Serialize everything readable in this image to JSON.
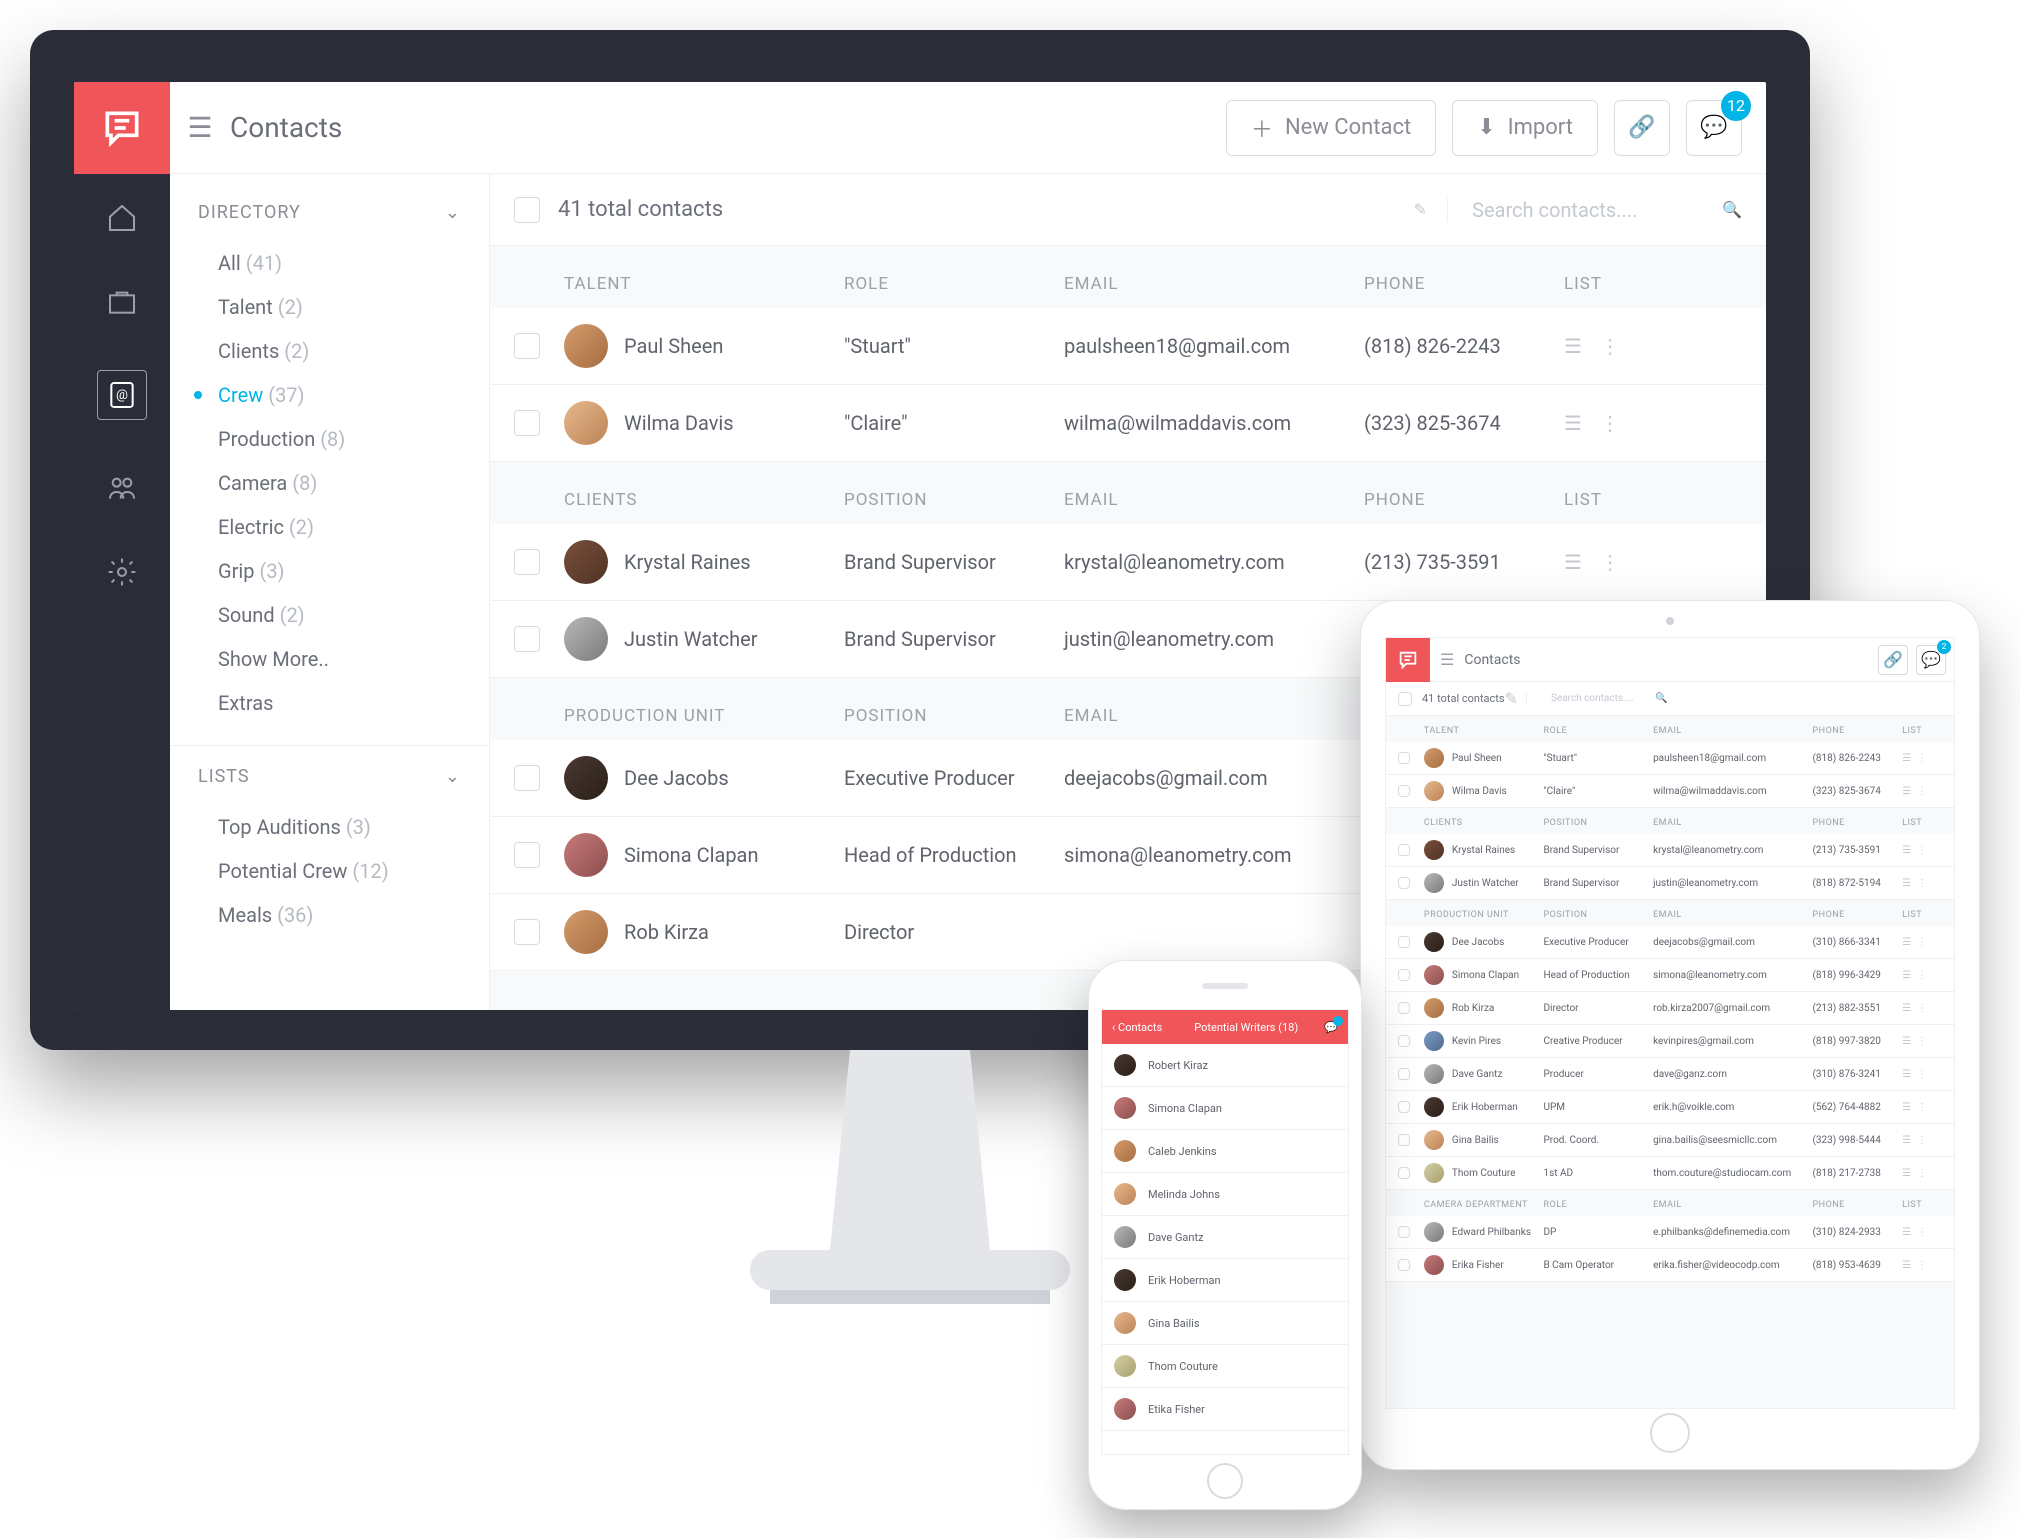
{
  "brand_color": "#f0555a",
  "accent_color": "#00b5e6",
  "desktop": {
    "page_title": "Contacts",
    "new_contact": "New Contact",
    "import": "Import",
    "chat_badge": "12",
    "total_contacts": "41 total contacts",
    "search_placeholder": "Search contacts....",
    "sidebar": {
      "directory_label": "DIRECTORY",
      "lists_label": "LISTS",
      "directory": [
        {
          "label": "All",
          "count": "(41)"
        },
        {
          "label": "Talent",
          "count": "(2)"
        },
        {
          "label": "Clients",
          "count": "(2)"
        },
        {
          "label": "Crew",
          "count": "(37)",
          "selected": true,
          "children": [
            {
              "label": "Production",
              "count": "(8)"
            },
            {
              "label": "Camera",
              "count": "(8)"
            },
            {
              "label": "Electric",
              "count": "(2)"
            },
            {
              "label": "Grip",
              "count": "(3)"
            },
            {
              "label": "Sound",
              "count": "(2)"
            },
            {
              "label": "Show More.."
            }
          ]
        },
        {
          "label": "Extras"
        }
      ],
      "lists": [
        {
          "label": "Top Auditions",
          "count": "(3)"
        },
        {
          "label": "Potential Crew",
          "count": "(12)"
        },
        {
          "label": "Meals",
          "count": "(36)"
        }
      ]
    },
    "groups": [
      {
        "title": "TALENT",
        "cols": [
          "ROLE",
          "EMAIL",
          "PHONE",
          "LIST"
        ],
        "rows": [
          {
            "name": "Paul Sheen",
            "role": "\"Stuart\"",
            "email": "paulsheen18@gmail.com",
            "phone": "(818) 826-2243",
            "av": "a1"
          },
          {
            "name": "Wilma Davis",
            "role": "\"Claire\"",
            "email": "wilma@wilmaddavis.com",
            "phone": "(323) 825-3674",
            "av": "a2"
          }
        ]
      },
      {
        "title": "CLIENTS",
        "cols": [
          "POSITION",
          "EMAIL",
          "PHONE",
          "LIST"
        ],
        "rows": [
          {
            "name": "Krystal Raines",
            "role": "Brand Supervisor",
            "email": "krystal@leanometry.com",
            "phone": "(213) 735-3591",
            "av": "a3"
          },
          {
            "name": "Justin Watcher",
            "role": "Brand Supervisor",
            "email": "justin@leanometry.com",
            "phone": "",
            "av": "a4"
          }
        ]
      },
      {
        "title": "PRODUCTION UNIT",
        "cols": [
          "POSITION",
          "EMAIL",
          "",
          ""
        ],
        "rows": [
          {
            "name": "Dee Jacobs",
            "role": "Executive Producer",
            "email": "deejacobs@gmail.com",
            "phone": "",
            "av": "a5"
          },
          {
            "name": "Simona Clapan",
            "role": "Head of Production",
            "email": "simona@leanometry.com",
            "phone": "",
            "av": "a6"
          },
          {
            "name": "Rob Kirza",
            "role": "Director",
            "email": "",
            "phone": "",
            "av": "a1"
          }
        ]
      }
    ]
  },
  "tablet": {
    "page_title": "Contacts",
    "chat_badge": "2",
    "total_contacts": "41 total contacts",
    "search_placeholder": "Search contacts....",
    "groups": [
      {
        "title": "TALENT",
        "cols": [
          "ROLE",
          "EMAIL",
          "PHONE",
          "LIST"
        ],
        "rows": [
          {
            "name": "Paul Sheen",
            "role": "\"Stuart\"",
            "email": "paulsheen18@gmail.com",
            "phone": "(818) 826-2243",
            "av": "a1"
          },
          {
            "name": "Wilma Davis",
            "role": "\"Claire\"",
            "email": "wilma@wilmaddavis.com",
            "phone": "(323) 825-3674",
            "av": "a2"
          }
        ]
      },
      {
        "title": "CLIENTS",
        "cols": [
          "POSITION",
          "EMAIL",
          "PHONE",
          "LIST"
        ],
        "rows": [
          {
            "name": "Krystal Raines",
            "role": "Brand Supervisor",
            "email": "krystal@leanometry.com",
            "phone": "(213) 735-3591",
            "av": "a3"
          },
          {
            "name": "Justin Watcher",
            "role": "Brand Supervisor",
            "email": "justin@leanometry.com",
            "phone": "(818) 872-5194",
            "av": "a4"
          }
        ]
      },
      {
        "title": "PRODUCTION UNIT",
        "cols": [
          "POSITION",
          "EMAIL",
          "PHONE",
          "LIST"
        ],
        "rows": [
          {
            "name": "Dee Jacobs",
            "role": "Executive Producer",
            "email": "deejacobs@gmail.com",
            "phone": "(310) 866-3341",
            "av": "a5"
          },
          {
            "name": "Simona Clapan",
            "role": "Head of Production",
            "email": "simona@leanometry.com",
            "phone": "(818) 996-3429",
            "av": "a6"
          },
          {
            "name": "Rob Kirza",
            "role": "Director",
            "email": "rob.kirza2007@gmail.com",
            "phone": "(213) 882-3551",
            "av": "a1"
          },
          {
            "name": "Kevin Pires",
            "role": "Creative Producer",
            "email": "kevinpires@gmail.com",
            "phone": "(818) 997-3820",
            "av": "a7"
          },
          {
            "name": "Dave Gantz",
            "role": "Producer",
            "email": "dave@ganz.com",
            "phone": "(310) 876-3241",
            "av": "a4"
          },
          {
            "name": "Erik Hoberman",
            "role": "UPM",
            "email": "erik.h@voikle.com",
            "phone": "(562) 764-4882",
            "av": "a5"
          },
          {
            "name": "Gina Bailis",
            "role": "Prod. Coord.",
            "email": "gina.bailis@seesmicllc.com",
            "phone": "(323) 998-5444",
            "av": "a2"
          },
          {
            "name": "Thom Couture",
            "role": "1st AD",
            "email": "thom.couture@studiocam.com",
            "phone": "(818) 217-2738",
            "av": "a8"
          }
        ]
      },
      {
        "title": "CAMERA DEPARTMENT",
        "cols": [
          "ROLE",
          "EMAIL",
          "PHONE",
          "LIST"
        ],
        "rows": [
          {
            "name": "Edward Philbanks",
            "role": "DP",
            "email": "e.philbanks@definemedia.com",
            "phone": "(310) 824-2933",
            "av": "a4"
          },
          {
            "name": "Erika Fisher",
            "role": "B Cam Operator",
            "email": "erika.fisher@videocodp.com",
            "phone": "(818) 953-4639",
            "av": "a6"
          }
        ]
      }
    ]
  },
  "phone": {
    "back_label": "Contacts",
    "title": "Potential Writers (18)",
    "rows": [
      {
        "name": "Robert Kiraz",
        "av": "a5"
      },
      {
        "name": "Simona Clapan",
        "av": "a6"
      },
      {
        "name": "Caleb Jenkins",
        "av": "a1"
      },
      {
        "name": "Melinda Johns",
        "av": "a2"
      },
      {
        "name": "Dave Gantz",
        "av": "a4"
      },
      {
        "name": "Erik Hoberman",
        "av": "a5"
      },
      {
        "name": "Gina Bailis",
        "av": "a2"
      },
      {
        "name": "Thom Couture",
        "av": "a8"
      },
      {
        "name": "Etika Fisher",
        "av": "a6"
      }
    ]
  }
}
